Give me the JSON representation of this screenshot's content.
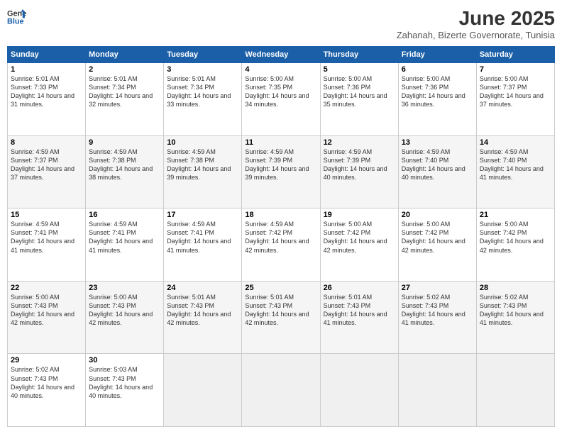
{
  "header": {
    "logo_line1": "General",
    "logo_line2": "Blue",
    "month": "June 2025",
    "location": "Zahanah, Bizerte Governorate, Tunisia"
  },
  "weekdays": [
    "Sunday",
    "Monday",
    "Tuesday",
    "Wednesday",
    "Thursday",
    "Friday",
    "Saturday"
  ],
  "weeks": [
    [
      {
        "day": "1",
        "sunrise": "5:01 AM",
        "sunset": "7:33 PM",
        "daylight": "14 hours and 31 minutes."
      },
      {
        "day": "2",
        "sunrise": "5:01 AM",
        "sunset": "7:34 PM",
        "daylight": "14 hours and 32 minutes."
      },
      {
        "day": "3",
        "sunrise": "5:01 AM",
        "sunset": "7:34 PM",
        "daylight": "14 hours and 33 minutes."
      },
      {
        "day": "4",
        "sunrise": "5:00 AM",
        "sunset": "7:35 PM",
        "daylight": "14 hours and 34 minutes."
      },
      {
        "day": "5",
        "sunrise": "5:00 AM",
        "sunset": "7:36 PM",
        "daylight": "14 hours and 35 minutes."
      },
      {
        "day": "6",
        "sunrise": "5:00 AM",
        "sunset": "7:36 PM",
        "daylight": "14 hours and 36 minutes."
      },
      {
        "day": "7",
        "sunrise": "5:00 AM",
        "sunset": "7:37 PM",
        "daylight": "14 hours and 37 minutes."
      }
    ],
    [
      {
        "day": "8",
        "sunrise": "4:59 AM",
        "sunset": "7:37 PM",
        "daylight": "14 hours and 37 minutes."
      },
      {
        "day": "9",
        "sunrise": "4:59 AM",
        "sunset": "7:38 PM",
        "daylight": "14 hours and 38 minutes."
      },
      {
        "day": "10",
        "sunrise": "4:59 AM",
        "sunset": "7:38 PM",
        "daylight": "14 hours and 39 minutes."
      },
      {
        "day": "11",
        "sunrise": "4:59 AM",
        "sunset": "7:39 PM",
        "daylight": "14 hours and 39 minutes."
      },
      {
        "day": "12",
        "sunrise": "4:59 AM",
        "sunset": "7:39 PM",
        "daylight": "14 hours and 40 minutes."
      },
      {
        "day": "13",
        "sunrise": "4:59 AM",
        "sunset": "7:40 PM",
        "daylight": "14 hours and 40 minutes."
      },
      {
        "day": "14",
        "sunrise": "4:59 AM",
        "sunset": "7:40 PM",
        "daylight": "14 hours and 41 minutes."
      }
    ],
    [
      {
        "day": "15",
        "sunrise": "4:59 AM",
        "sunset": "7:41 PM",
        "daylight": "14 hours and 41 minutes."
      },
      {
        "day": "16",
        "sunrise": "4:59 AM",
        "sunset": "7:41 PM",
        "daylight": "14 hours and 41 minutes."
      },
      {
        "day": "17",
        "sunrise": "4:59 AM",
        "sunset": "7:41 PM",
        "daylight": "14 hours and 41 minutes."
      },
      {
        "day": "18",
        "sunrise": "4:59 AM",
        "sunset": "7:42 PM",
        "daylight": "14 hours and 42 minutes."
      },
      {
        "day": "19",
        "sunrise": "5:00 AM",
        "sunset": "7:42 PM",
        "daylight": "14 hours and 42 minutes."
      },
      {
        "day": "20",
        "sunrise": "5:00 AM",
        "sunset": "7:42 PM",
        "daylight": "14 hours and 42 minutes."
      },
      {
        "day": "21",
        "sunrise": "5:00 AM",
        "sunset": "7:42 PM",
        "daylight": "14 hours and 42 minutes."
      }
    ],
    [
      {
        "day": "22",
        "sunrise": "5:00 AM",
        "sunset": "7:43 PM",
        "daylight": "14 hours and 42 minutes."
      },
      {
        "day": "23",
        "sunrise": "5:00 AM",
        "sunset": "7:43 PM",
        "daylight": "14 hours and 42 minutes."
      },
      {
        "day": "24",
        "sunrise": "5:01 AM",
        "sunset": "7:43 PM",
        "daylight": "14 hours and 42 minutes."
      },
      {
        "day": "25",
        "sunrise": "5:01 AM",
        "sunset": "7:43 PM",
        "daylight": "14 hours and 42 minutes."
      },
      {
        "day": "26",
        "sunrise": "5:01 AM",
        "sunset": "7:43 PM",
        "daylight": "14 hours and 41 minutes."
      },
      {
        "day": "27",
        "sunrise": "5:02 AM",
        "sunset": "7:43 PM",
        "daylight": "14 hours and 41 minutes."
      },
      {
        "day": "28",
        "sunrise": "5:02 AM",
        "sunset": "7:43 PM",
        "daylight": "14 hours and 41 minutes."
      }
    ],
    [
      {
        "day": "29",
        "sunrise": "5:02 AM",
        "sunset": "7:43 PM",
        "daylight": "14 hours and 40 minutes."
      },
      {
        "day": "30",
        "sunrise": "5:03 AM",
        "sunset": "7:43 PM",
        "daylight": "14 hours and 40 minutes."
      },
      null,
      null,
      null,
      null,
      null
    ]
  ]
}
